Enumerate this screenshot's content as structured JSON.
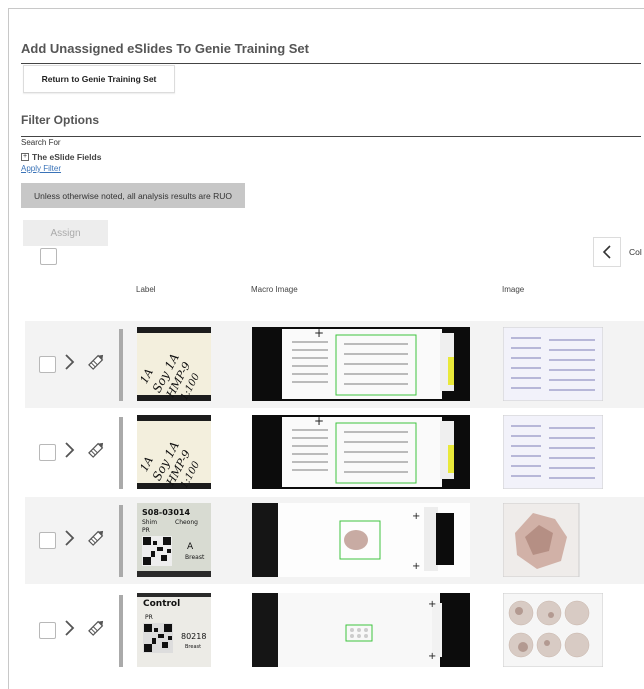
{
  "page": {
    "title": "Add Unassigned eSlides To Genie Training Set",
    "return_button": "Return to Genie Training Set"
  },
  "filter": {
    "title": "Filter Options",
    "search_for": "Search For",
    "eslide_fields": "The eSlide Fields",
    "apply_filter": "Apply Filter"
  },
  "notice": "Unless otherwise noted, all analysis results are RUO",
  "toolbar": {
    "assign_label": "Assign",
    "prev_icon": "chevron-left-icon",
    "columns_label": "Col"
  },
  "table": {
    "headers": [
      "Label",
      "Macro Image",
      "Image"
    ],
    "rows": [
      {
        "label_text": [
          "1A",
          "Soy 1A",
          "HMP-9",
          "1:100"
        ],
        "macro_type": "tma-array",
        "image_type": "tma-array"
      },
      {
        "label_text": [
          "1A",
          "Soy 1A",
          "HMP-9",
          "1:100"
        ],
        "macro_type": "tma-array",
        "image_type": "tma-array"
      },
      {
        "label_text": [
          "S08-03014",
          "Shim",
          "Cheong",
          "PR",
          "A",
          "Breast"
        ],
        "macro_type": "tissue-section",
        "image_type": "tissue-section"
      },
      {
        "label_text": [
          "Control",
          "PR",
          "80218",
          "Breast"
        ],
        "macro_type": "small-array",
        "image_type": "control-cores"
      }
    ]
  },
  "colors": {
    "accent_link": "#3a73b8",
    "banner_bg": "#c7c7c7",
    "selection_box": "#3ec43e"
  }
}
